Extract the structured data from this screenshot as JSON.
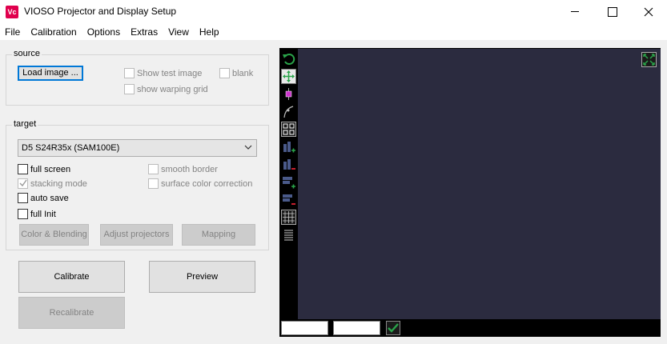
{
  "window": {
    "app_icon_text": "Vc",
    "title": "VIOSO Projector and Display Setup"
  },
  "menu": [
    "File",
    "Calibration",
    "Options",
    "Extras",
    "View",
    "Help"
  ],
  "source": {
    "label": "source",
    "load_image": "Load image ...",
    "show_test_image": "Show test image",
    "blank": "blank",
    "show_warping_grid": "show warping grid"
  },
  "target": {
    "label": "target",
    "display_selected": "D5 S24R35x (SAM100E)",
    "full_screen": "full screen",
    "smooth_border": "smooth border",
    "stacking_mode": "stacking mode",
    "surface_color_correction": "surface color correction",
    "auto_save": "auto save",
    "full_init": "full Init",
    "color_blending": "Color & Blending",
    "adjust_projectors": "Adjust projectors",
    "mapping": "Mapping"
  },
  "actions": {
    "calibrate": "Calibrate",
    "preview": "Preview",
    "recalibrate": "Recalibrate"
  },
  "colors": {
    "canvas": "#2b2b3f",
    "accent_green": "#2aa44a",
    "accent_magenta": "#cc33cc",
    "brand": "#e0004d"
  }
}
